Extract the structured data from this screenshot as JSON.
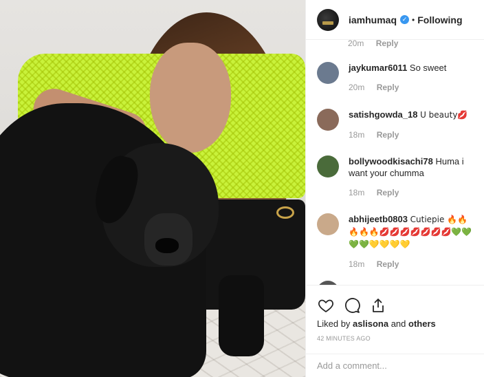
{
  "post": {
    "username": "iamhumaq",
    "follow_state": "Following",
    "separator": "•"
  },
  "clipped_comment": {
    "time": "20m",
    "reply": "Reply"
  },
  "comments": [
    {
      "user": "jaykumar6011",
      "text": "So sweet",
      "time": "20m",
      "reply": "Reply",
      "avatar_color": "#6b7a8f"
    },
    {
      "user": "satishgowda_18",
      "text": "U beauty💋",
      "time": "18m",
      "reply": "Reply",
      "avatar_color": "#8a6a5a"
    },
    {
      "user": "bollywoodkisachi78",
      "text": "Huma i want your chumma",
      "time": "18m",
      "reply": "Reply",
      "avatar_color": "#4a6b3a"
    },
    {
      "user": "abhijeetb0803",
      "text": "Cutiepie 🔥🔥🔥🔥🔥💋💋💋💋💋💋💋💚💚💚💚💛💛💛💛",
      "time": "18m",
      "reply": "Reply",
      "avatar_color": "#c9a98a"
    }
  ],
  "actions": {
    "liked_prefix": "Liked by",
    "liked_user": "aslisona",
    "liked_and": "and",
    "liked_others": "others",
    "time_ago": "42 MINUTES AGO"
  },
  "add_comment": {
    "placeholder": "Add a comment..."
  },
  "icons": [
    "heart-icon",
    "comment-icon",
    "share-icon"
  ]
}
